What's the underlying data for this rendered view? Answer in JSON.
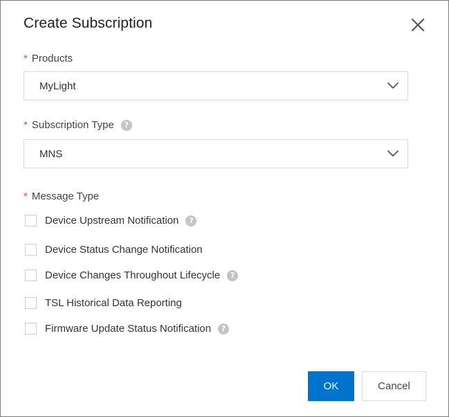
{
  "dialog": {
    "title": "Create Subscription",
    "close_icon": "close-icon"
  },
  "fields": {
    "products": {
      "required_mark": "*",
      "label": "Products",
      "value": "MyLight"
    },
    "subscription_type": {
      "required_mark": "*",
      "label": "Subscription Type",
      "help": "?",
      "value": "MNS"
    },
    "message_type": {
      "required_mark": "*",
      "label": "Message Type",
      "options": [
        {
          "label": "Device Upstream Notification",
          "checked": false,
          "help": "?"
        },
        {
          "label": "Device Status Change Notification",
          "checked": false
        },
        {
          "label": "Device Changes Throughout Lifecycle",
          "checked": false,
          "help": "?"
        },
        {
          "label": "TSL Historical Data Reporting",
          "checked": false
        },
        {
          "label": "Firmware Update Status Notification",
          "checked": false,
          "help": "?"
        }
      ]
    }
  },
  "footer": {
    "ok_label": "OK",
    "cancel_label": "Cancel"
  },
  "colors": {
    "primary": "#0073cf",
    "required": "#e84a3a",
    "border": "#d9d9d9",
    "help_icon": "#c4c4c4"
  }
}
